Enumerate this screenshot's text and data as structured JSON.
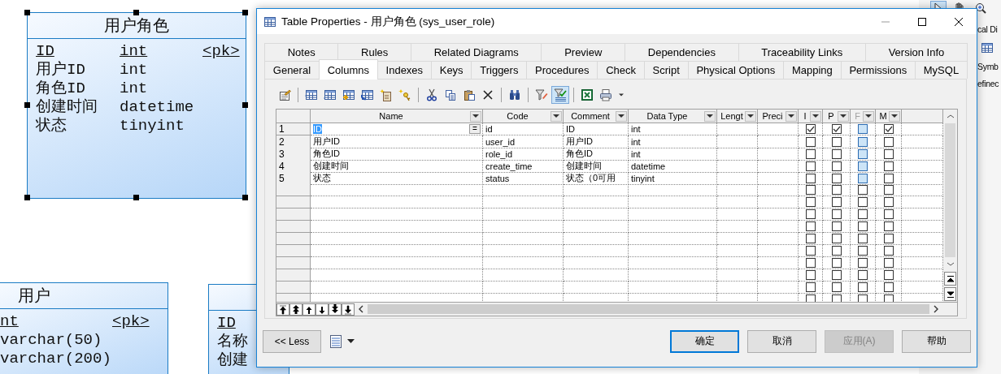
{
  "canvas": {
    "entities": [
      {
        "title": "用户角色",
        "selected": true,
        "rows": [
          {
            "name": "ID",
            "type": "int",
            "key": "<pk>",
            "primary": true
          },
          {
            "name": "用户ID",
            "type": "int",
            "primary": false
          },
          {
            "name": "角色ID",
            "type": "int",
            "primary": false
          },
          {
            "name": "创建时间",
            "type": "datetime",
            "primary": false
          },
          {
            "name": "状态",
            "type": "tinyint",
            "primary": false
          }
        ]
      },
      {
        "title": "用户",
        "selected": false,
        "rows": [
          {
            "type": "nt",
            "key": "<pk>",
            "primary": true
          },
          {
            "type": "varchar(50)",
            "primary": false
          },
          {
            "type": "varchar(200)",
            "primary": false
          }
        ]
      },
      {
        "selected": false,
        "rows": [
          {
            "name": "ID",
            "primary": true
          },
          {
            "name": "名称",
            "primary": false
          },
          {
            "name": "创建",
            "primary": false
          }
        ]
      }
    ]
  },
  "side_panel": {
    "toolbar": [
      {
        "kind": "pointer",
        "pressed": true
      },
      {
        "kind": "hand",
        "pressed": false
      },
      {
        "kind": "zoom",
        "pressed": false
      }
    ],
    "lines": [
      "cal Di",
      "Symb",
      "efinec"
    ]
  },
  "dialog": {
    "title": "Table Properties - 用户角色 (sys_user_role)",
    "tab_rows": [
      [
        {
          "label": "Notes",
          "selected": false
        },
        {
          "label": "Rules",
          "selected": false
        },
        {
          "label": "Related Diagrams",
          "selected": false
        },
        {
          "label": "Preview",
          "selected": false
        },
        {
          "label": "Dependencies",
          "selected": false
        },
        {
          "label": "Traceability Links",
          "selected": false
        },
        {
          "label": "Version Info",
          "selected": false
        }
      ],
      [
        {
          "label": "General",
          "selected": false
        },
        {
          "label": "Columns",
          "selected": true
        },
        {
          "label": "Indexes",
          "selected": false
        },
        {
          "label": "Keys",
          "selected": false
        },
        {
          "label": "Triggers",
          "selected": false
        },
        {
          "label": "Procedures",
          "selected": false
        },
        {
          "label": "Check",
          "selected": false
        },
        {
          "label": "Script",
          "selected": false
        },
        {
          "label": "Physical Options",
          "selected": false
        },
        {
          "label": "Mapping",
          "selected": false
        },
        {
          "label": "Permissions",
          "selected": false
        },
        {
          "label": "MySQL",
          "selected": false
        }
      ]
    ],
    "toolbar": [
      {
        "kind": "properties",
        "pressed": false
      },
      {
        "kind": "separator"
      },
      {
        "kind": "insert-row",
        "pressed": false
      },
      {
        "kind": "add-row",
        "pressed": false
      },
      {
        "kind": "add-columns",
        "pressed": false
      },
      {
        "kind": "replicate",
        "pressed": false
      },
      {
        "kind": "new-document",
        "pressed": false
      },
      {
        "kind": "key",
        "pressed": false
      },
      {
        "kind": "separator"
      },
      {
        "kind": "cut",
        "pressed": false
      },
      {
        "kind": "copy",
        "pressed": false
      },
      {
        "kind": "paste",
        "pressed": false
      },
      {
        "kind": "delete",
        "pressed": false
      },
      {
        "kind": "separator"
      },
      {
        "kind": "find",
        "pressed": false
      },
      {
        "kind": "separator"
      },
      {
        "kind": "filter-edit",
        "pressed": false
      },
      {
        "kind": "filter",
        "pressed": true
      },
      {
        "kind": "separator"
      },
      {
        "kind": "spreadsheet",
        "pressed": false
      },
      {
        "kind": "print",
        "pressed": false
      },
      {
        "kind": "caret",
        "pressed": false
      }
    ],
    "grid": {
      "columns": [
        {
          "label": "Name",
          "disabled": false
        },
        {
          "label": "Code",
          "disabled": false
        },
        {
          "label": "Comment",
          "disabled": false
        },
        {
          "label": "Data Type",
          "disabled": false
        },
        {
          "label": "Lengt",
          "disabled": false
        },
        {
          "label": "Preci",
          "disabled": false
        },
        {
          "label": "I",
          "disabled": false
        },
        {
          "label": "P",
          "disabled": false
        },
        {
          "label": "F",
          "disabled": true
        },
        {
          "label": "M",
          "disabled": false
        }
      ],
      "cell_button": "=",
      "rows": [
        {
          "number": "1",
          "name": "ID",
          "code": "id",
          "comment": "ID",
          "data_type": "int",
          "editing": true,
          "i": true,
          "p": true,
          "f": false,
          "f_disabled": true,
          "m": true
        },
        {
          "number": "2",
          "name": "用户ID",
          "code": "user_id",
          "comment": "用户ID",
          "data_type": "int",
          "editing": false,
          "i": false,
          "p": false,
          "f": false,
          "f_disabled": true,
          "m": false
        },
        {
          "number": "3",
          "name": "角色ID",
          "code": "role_id",
          "comment": "角色ID",
          "data_type": "int",
          "editing": false,
          "i": false,
          "p": false,
          "f": false,
          "f_disabled": true,
          "m": false
        },
        {
          "number": "4",
          "name": "创建时间",
          "code": "create_time",
          "comment": "创建时间",
          "data_type": "datetime",
          "editing": false,
          "i": false,
          "p": false,
          "f": false,
          "f_disabled": true,
          "m": false
        },
        {
          "number": "5",
          "name": "状态",
          "code": "status",
          "comment": "状态（0可用",
          "data_type": "tinyint",
          "editing": false,
          "i": false,
          "p": false,
          "f": false,
          "f_disabled": true,
          "m": false
        }
      ],
      "blank_rows": [
        {
          "i": false,
          "p": false,
          "f": false,
          "f_disabled": false,
          "m": false
        },
        {
          "i": false,
          "p": false,
          "f": false,
          "f_disabled": false,
          "m": false
        },
        {
          "i": false,
          "p": false,
          "f": false,
          "f_disabled": false,
          "m": false
        },
        {
          "i": false,
          "p": false,
          "f": false,
          "f_disabled": false,
          "m": false
        },
        {
          "i": false,
          "p": false,
          "f": false,
          "f_disabled": false,
          "m": false
        },
        {
          "i": false,
          "p": false,
          "f": false,
          "f_disabled": false,
          "m": false
        },
        {
          "i": false,
          "p": false,
          "f": false,
          "f_disabled": false,
          "m": false
        },
        {
          "i": false,
          "p": false,
          "f": false,
          "f_disabled": false,
          "m": false
        },
        {
          "i": false,
          "p": false,
          "f": false,
          "f_disabled": false,
          "m": false
        },
        {
          "i": false,
          "p": false,
          "f": false,
          "f_disabled": false,
          "m": false
        }
      ],
      "move_buttons": [
        {
          "kind": "first"
        },
        {
          "kind": "page-up"
        },
        {
          "kind": "up"
        },
        {
          "kind": "down"
        },
        {
          "kind": "page-down"
        },
        {
          "kind": "last"
        }
      ]
    },
    "footer": {
      "less_button": "<< Less",
      "buttons": [
        {
          "label": "确定",
          "default": true,
          "disabled": false
        },
        {
          "label": "取消",
          "default": false,
          "disabled": false
        },
        {
          "label": "应用(A)",
          "default": false,
          "disabled": true
        },
        {
          "label": "帮助",
          "default": false,
          "disabled": false
        }
      ]
    }
  }
}
